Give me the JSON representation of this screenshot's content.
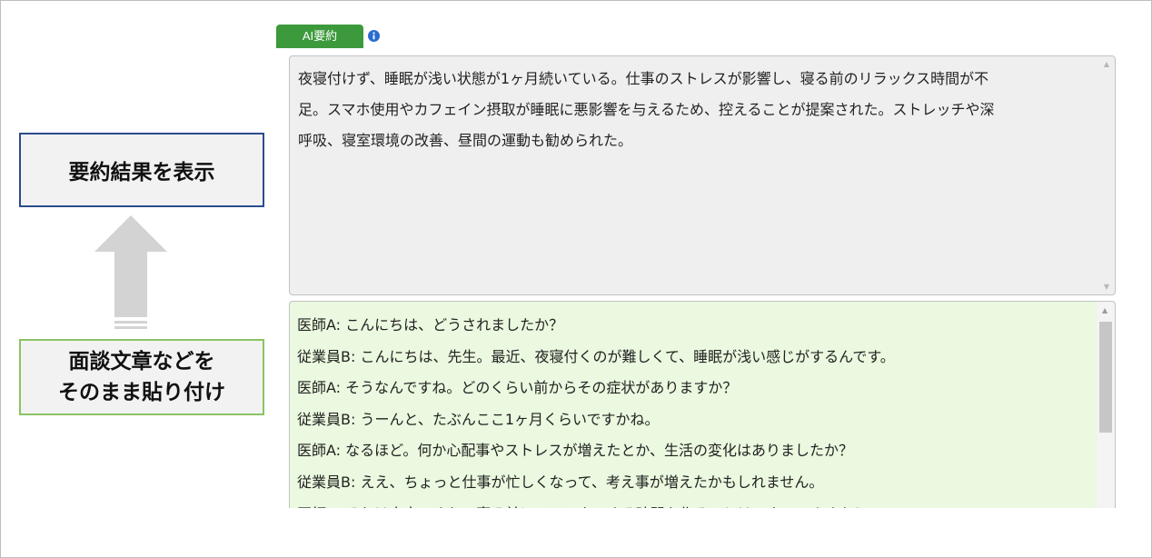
{
  "header": {
    "ai_button_label": "AI要約",
    "info_icon": "info-icon"
  },
  "summary": {
    "text": "夜寝付けず、睡眠が浅い状態が1ヶ月続いている。仕事のストレスが影響し、寝る前のリラックス時間が不\n足。スマホ使用やカフェイン摂取が睡眠に悪影響を与えるため、控えることが提案された。ストレッチや深\n呼吸、寝室環境の改善、昼間の運動も勧められた。"
  },
  "dialog": {
    "lines": [
      "医師A: こんにちは、どうされましたか？",
      "従業員B: こんにちは、先生。最近、夜寝付くのが難しくて、睡眠が浅い感じがするんです。",
      "医師A: そうなんですね。どのくらい前からその症状がありますか？",
      "従業員B: うーんと、たぶんここ1ヶ月くらいですかね。",
      "医師A: なるほど。何か心配事やストレスが増えたとか、生活の変化はありましたか？",
      "従業員B: ええ、ちょっと仕事が忙しくなって、考え事が増えたかもしれません。",
      "医師A: それは大変ですね。寝る前にリラックスする時間を作ることはできていますか？"
    ]
  },
  "callouts": {
    "result_label": "要約結果を表示",
    "paste_label_line1": "面談文章などを",
    "paste_label_line2": "そのまま貼り付け"
  },
  "colors": {
    "accent_green": "#3c9a3c",
    "summary_bg": "#efefef",
    "dialog_bg": "#eaf9df",
    "result_border": "#2b4b8c",
    "paste_border": "#8cc264",
    "arrow": "#d3d3d3"
  }
}
